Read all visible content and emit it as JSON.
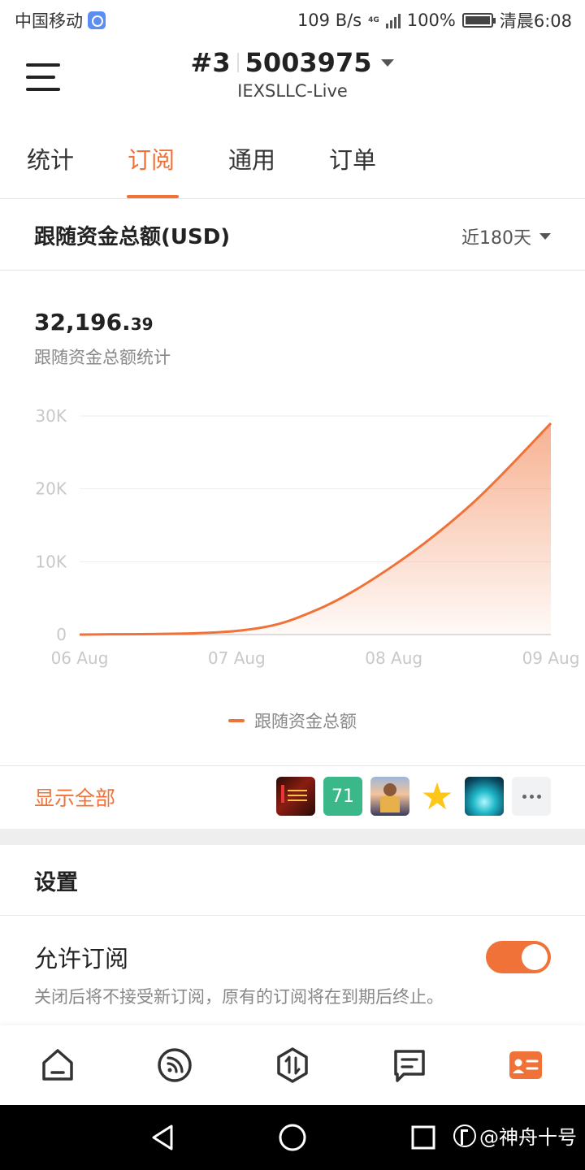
{
  "status_bar": {
    "carrier": "中国移动",
    "speed": "109 B/s",
    "network_type": "4G",
    "battery": "100%",
    "time": "清晨6:08"
  },
  "header": {
    "account_number": "#3",
    "account_id": "5003975",
    "server": "IEXSLLC-Live"
  },
  "tabs": [
    {
      "label": "统计",
      "active": false
    },
    {
      "label": "订阅",
      "active": true
    },
    {
      "label": "通用",
      "active": false
    },
    {
      "label": "订单",
      "active": false
    }
  ],
  "follow_section": {
    "title": "跟随资金总额(USD)",
    "range": "近180天",
    "value_int": "32,196.",
    "value_dec": "39",
    "caption": "跟随资金总额统计"
  },
  "chart_data": {
    "type": "area",
    "x": [
      "06 Aug",
      "07 Aug",
      "08 Aug",
      "09 Aug"
    ],
    "series": [
      {
        "name": "跟随资金总额",
        "points": [
          [
            0,
            0
          ],
          [
            1,
            500
          ],
          [
            1.5,
            3300
          ],
          [
            2,
            9500
          ],
          [
            2.5,
            18000
          ],
          [
            3,
            29000
          ]
        ]
      }
    ],
    "y_ticks": [
      "0",
      "10K",
      "20K",
      "30K"
    ],
    "ylim": [
      0,
      30000
    ],
    "grid": true,
    "color": "#f07238",
    "legend": "bottom"
  },
  "avatars_row": {
    "show_all": "显示全部",
    "avatars": [
      {
        "icon": "trading-chart-avatar"
      },
      {
        "text": "71"
      },
      {
        "icon": "person-photo-avatar"
      },
      {
        "icon": "star-avatar",
        "glyph": "★"
      },
      {
        "icon": "teal-glow-avatar"
      },
      {
        "icon": "more-icon"
      }
    ]
  },
  "settings": {
    "title": "设置",
    "allow_label": "允许订阅",
    "allow_desc": "关闭后将不接受新订阅，原有的订阅将在到期后终止。",
    "allow_enabled": true
  },
  "bottom_nav": [
    {
      "icon": "home-icon"
    },
    {
      "icon": "signal-feed-icon"
    },
    {
      "icon": "trade-icon"
    },
    {
      "icon": "message-icon"
    },
    {
      "icon": "profile-card-icon",
      "active": true
    }
  ],
  "watermark": "@神舟十号"
}
